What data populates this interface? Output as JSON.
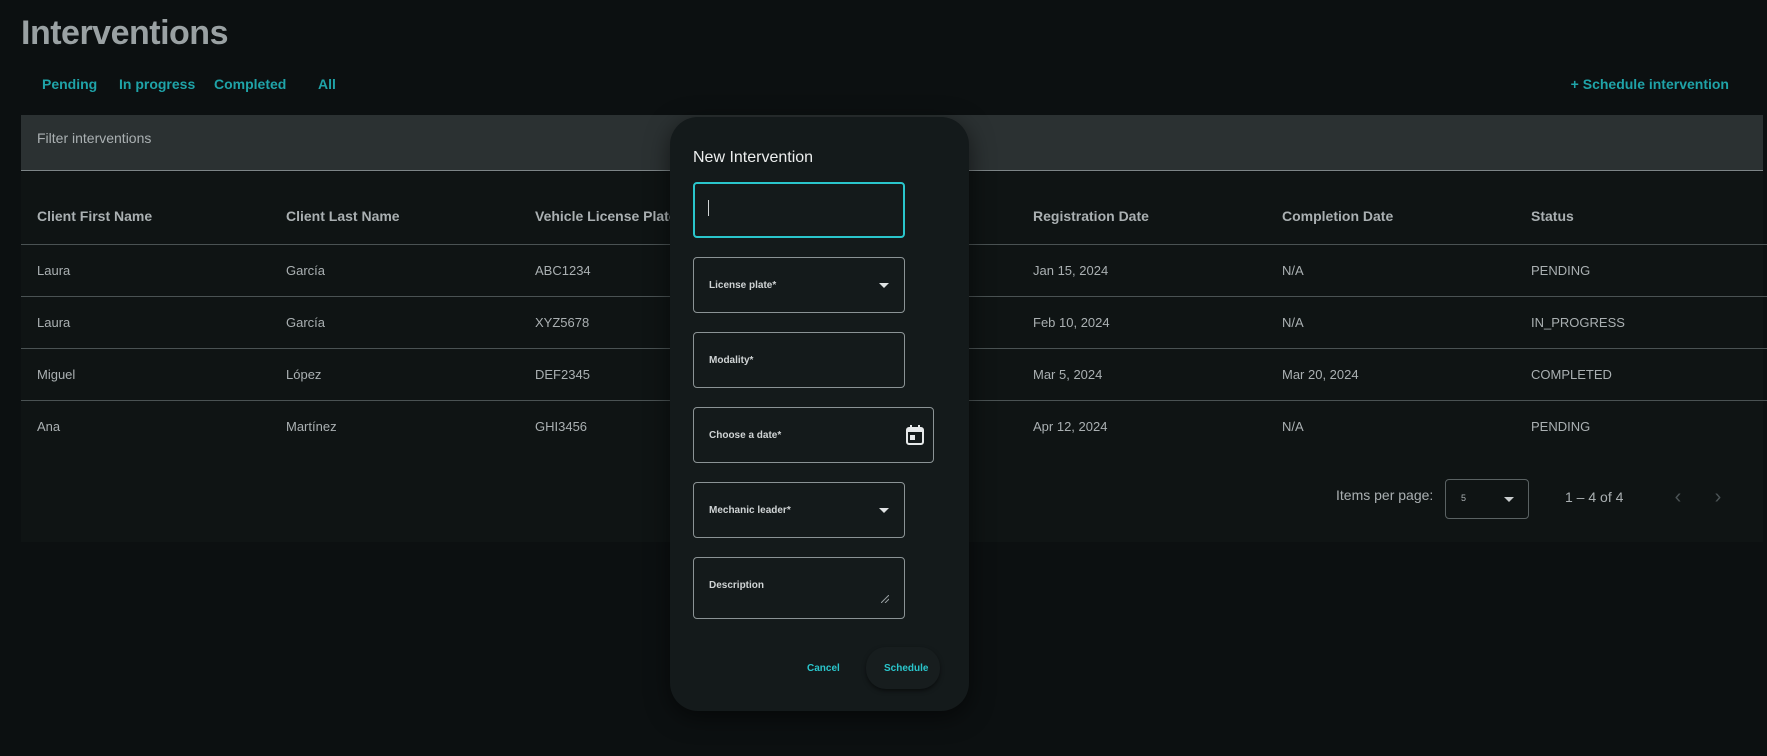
{
  "page": {
    "title": "Interventions"
  },
  "tabs": [
    {
      "label": "Pending"
    },
    {
      "label": "In progress"
    },
    {
      "label": "Completed"
    },
    {
      "label": "All"
    }
  ],
  "actions": {
    "schedule_label": "+ Schedule intervention"
  },
  "filter": {
    "label": "Filter interventions"
  },
  "table": {
    "columns": [
      "Client First Name",
      "Client Last Name",
      "Vehicle License Plate",
      "",
      "Registration Date",
      "Completion Date",
      "Status"
    ],
    "rows": [
      [
        "Laura",
        "García",
        "ABC1234",
        "",
        "Jan 15, 2024",
        "N/A",
        "PENDING"
      ],
      [
        "Laura",
        "García",
        "XYZ5678",
        "",
        "Feb 10, 2024",
        "N/A",
        "IN_PROGRESS"
      ],
      [
        "Miguel",
        "López",
        "DEF2345",
        "",
        "Mar 5, 2024",
        "Mar 20, 2024",
        "COMPLETED"
      ],
      [
        "Ana",
        "Martínez",
        "GHI3456",
        "",
        "Apr 12, 2024",
        "N/A",
        "PENDING"
      ]
    ]
  },
  "paginator": {
    "items_per_page_label": "Items per page:",
    "page_size": "5",
    "range_label": "1 – 4 of 4",
    "prev_icon": "chevron-left-icon",
    "next_icon": "chevron-right-icon"
  },
  "dialog": {
    "title": "New Intervention",
    "fields": [
      {
        "label": "",
        "value": ""
      },
      {
        "label": "License plate*"
      },
      {
        "label": "Modality*"
      },
      {
        "label": "Choose a date*"
      },
      {
        "label": "Mechanic leader*"
      },
      {
        "label": "Description"
      }
    ],
    "cancel_label": "Cancel",
    "submit_label": "Schedule"
  },
  "colors": {
    "background": "#0c1011",
    "accent": "#1fa3a8",
    "focus": "#2ac6cc",
    "dialog_bg": "#141a1b"
  }
}
